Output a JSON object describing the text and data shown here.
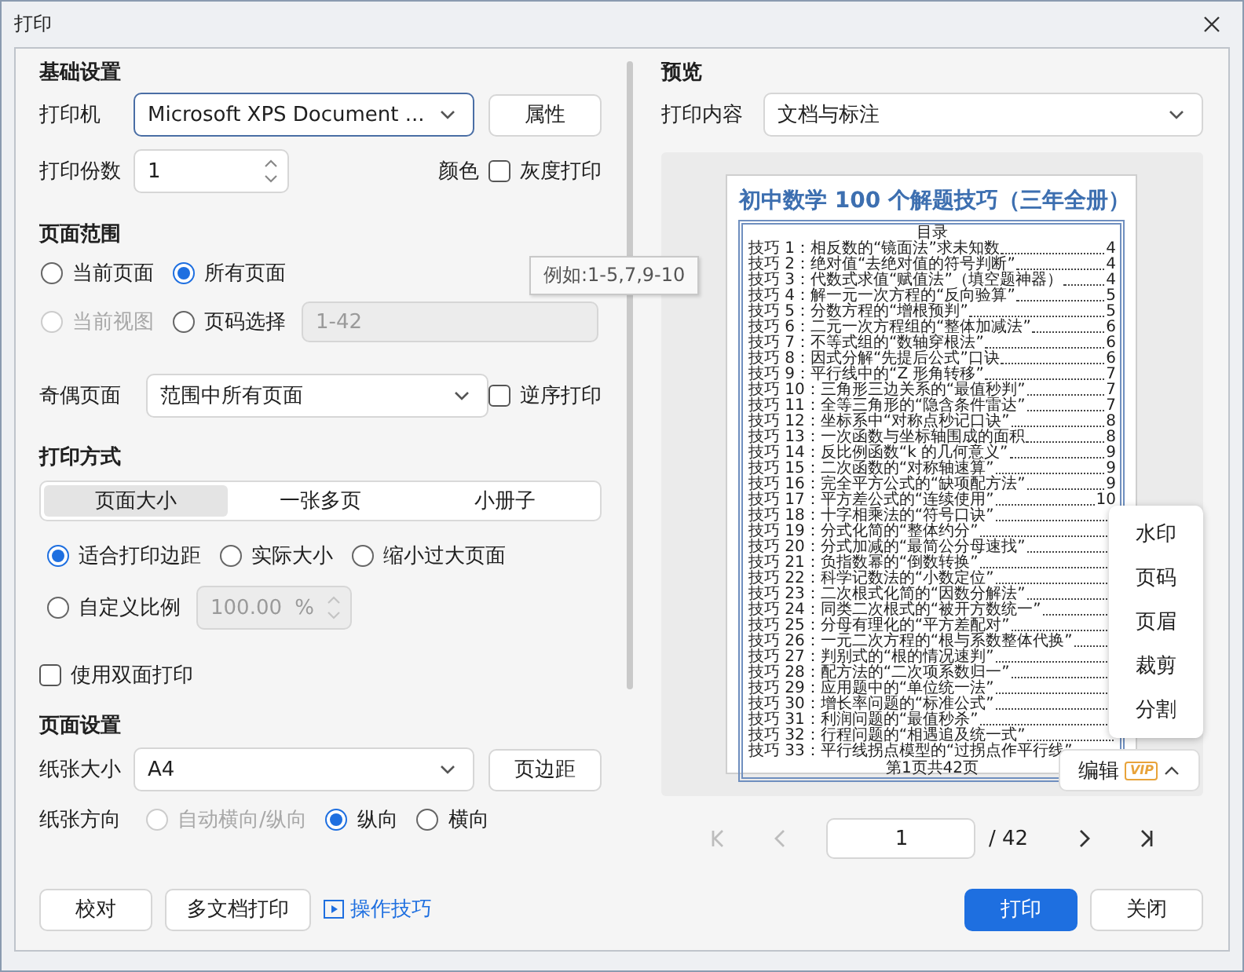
{
  "window": {
    "title": "打印"
  },
  "basic": {
    "heading": "基础设置",
    "printer_label": "打印机",
    "printer": "Microsoft XPS Document ...",
    "properties_button": "属性",
    "copies_label": "打印份数",
    "copies": "1",
    "color_label": "颜色",
    "grayscale": {
      "label": "灰度打印",
      "checked": false
    }
  },
  "range": {
    "heading": "页面范围",
    "options": [
      {
        "label": "当前页面",
        "selected": false,
        "disabled": false
      },
      {
        "label": "所有页面",
        "selected": true,
        "disabled": false
      },
      {
        "label": "当前视图",
        "selected": false,
        "disabled": true
      },
      {
        "label": "页码选择",
        "selected": false,
        "disabled": false
      }
    ],
    "page_input": {
      "value": "1-42",
      "disabled": true
    },
    "tooltip": "例如:1-5,7,9-10",
    "odd_even_label": "奇偶页面",
    "odd_even": "范围中所有页面",
    "reverse": {
      "label": "逆序打印",
      "checked": false
    }
  },
  "mode": {
    "heading": "打印方式",
    "tabs": [
      {
        "label": "页面大小",
        "selected": true
      },
      {
        "label": "一张多页",
        "selected": false
      },
      {
        "label": "小册子",
        "selected": false
      }
    ],
    "scale_options": [
      {
        "label": "适合打印边距",
        "selected": true
      },
      {
        "label": "实际大小",
        "selected": false
      },
      {
        "label": "缩小过大页面",
        "selected": false
      },
      {
        "label": "自定义比例",
        "selected": false
      }
    ],
    "custom_scale": {
      "value": "100.00",
      "unit": "%",
      "disabled": true
    },
    "duplex": {
      "label": "使用双面打印",
      "checked": false
    }
  },
  "page_setup": {
    "heading": "页面设置",
    "size_label": "纸张大小",
    "size": "A4",
    "margins_button": "页边距",
    "orientation_label": "纸张方向",
    "orientation": [
      {
        "label": "自动横向/纵向",
        "selected": false,
        "disabled": true
      },
      {
        "label": "纵向",
        "selected": true,
        "disabled": false
      },
      {
        "label": "横向",
        "selected": false,
        "disabled": false
      }
    ]
  },
  "footer": {
    "buttons": [
      "校对",
      "多文档打印"
    ],
    "tips_link": "操作技巧"
  },
  "preview": {
    "heading": "预览",
    "content_label": "打印内容",
    "content": "文档与标注",
    "document": {
      "title": "初中数学 100 个解题技巧（三年全册）",
      "toc_heading": "目录",
      "entries": [
        {
          "text": "技巧 1：相反数的“镜面法”求未知数",
          "page": "4"
        },
        {
          "text": "技巧 2：绝对值“去绝对值的符号判断”",
          "page": "4"
        },
        {
          "text": "技巧 3：代数式求值“赋值法”（填空题神器）",
          "page": "4"
        },
        {
          "text": "技巧 4：解一元一次方程的“反向验算”",
          "page": "5"
        },
        {
          "text": "技巧 5：分数方程的“增根预判”",
          "page": "5"
        },
        {
          "text": "技巧 6：二元一次方程组的“整体加减法”",
          "page": "6"
        },
        {
          "text": "技巧 7：不等式组的“数轴穿根法”",
          "page": "6"
        },
        {
          "text": "技巧 8：因式分解“先提后公式”口诀",
          "page": "6"
        },
        {
          "text": "技巧 9：平行线中的“Z 形角转移”",
          "page": "7"
        },
        {
          "text": "技巧 10：三角形三边关系的“最值秒判”",
          "page": "7"
        },
        {
          "text": "技巧 11：全等三角形的“隐含条件雷达”",
          "page": "7"
        },
        {
          "text": "技巧 12：坐标系中“对称点秒记口诀”",
          "page": "8"
        },
        {
          "text": "技巧 13：一次函数与坐标轴围成的面积",
          "page": "8"
        },
        {
          "text": "技巧 14：反比例函数“k 的几何意义”",
          "page": "9"
        },
        {
          "text": "技巧 15：二次函数的“对称轴速算”",
          "page": "9"
        },
        {
          "text": "技巧 16：完全平方公式的“缺项配方法”",
          "page": "9"
        },
        {
          "text": "技巧 17：平方差公式的“连续使用”",
          "page": "10"
        },
        {
          "text": "技巧 18：十字相乘法的“符号口诀”"
        },
        {
          "text": "技巧 19：分式化简的“整体约分”"
        },
        {
          "text": "技巧 20：分式加减的“最简公分母速找”"
        },
        {
          "text": "技巧 21：负指数幂的“倒数转换”"
        },
        {
          "text": "技巧 22：科学记数法的“小数定位”"
        },
        {
          "text": "技巧 23：二次根式化简的“因数分解法”"
        },
        {
          "text": "技巧 24：同类二次根式的“被开方数统一”"
        },
        {
          "text": "技巧 25：分母有理化的“平方差配对”"
        },
        {
          "text": "技巧 26：一元二次方程的“根与系数整体代换”"
        },
        {
          "text": "技巧 27：判别式的“根的情况速判”"
        },
        {
          "text": "技巧 28：配方法的“二次项系数归一”"
        },
        {
          "text": "技巧 29：应用题中的“单位统一法”"
        },
        {
          "text": "技巧 30：增长率问题的“标准公式”"
        },
        {
          "text": "技巧 31：利润问题的“最值秒杀”"
        },
        {
          "text": "技巧 32：行程问题的“相遇追及统一式”"
        },
        {
          "text": "技巧 33：平行线拐点模型的“过拐点作平行线”"
        }
      ],
      "footer": "第1页共42页"
    },
    "menu": [
      "水印",
      "页码",
      "页眉",
      "裁剪",
      "分割"
    ],
    "edit_button": {
      "label": "编辑",
      "badge": "VIP"
    },
    "pager": {
      "page": "1",
      "total": "/ 42",
      "nav": [
        {
          "kind": "first",
          "disabled": true
        },
        {
          "kind": "prev",
          "disabled": true
        },
        {
          "kind": "next",
          "disabled": false
        },
        {
          "kind": "last",
          "disabled": false
        }
      ]
    }
  },
  "actions": [
    {
      "label": "打印",
      "primary": true
    },
    {
      "label": "关闭",
      "primary": false
    }
  ]
}
